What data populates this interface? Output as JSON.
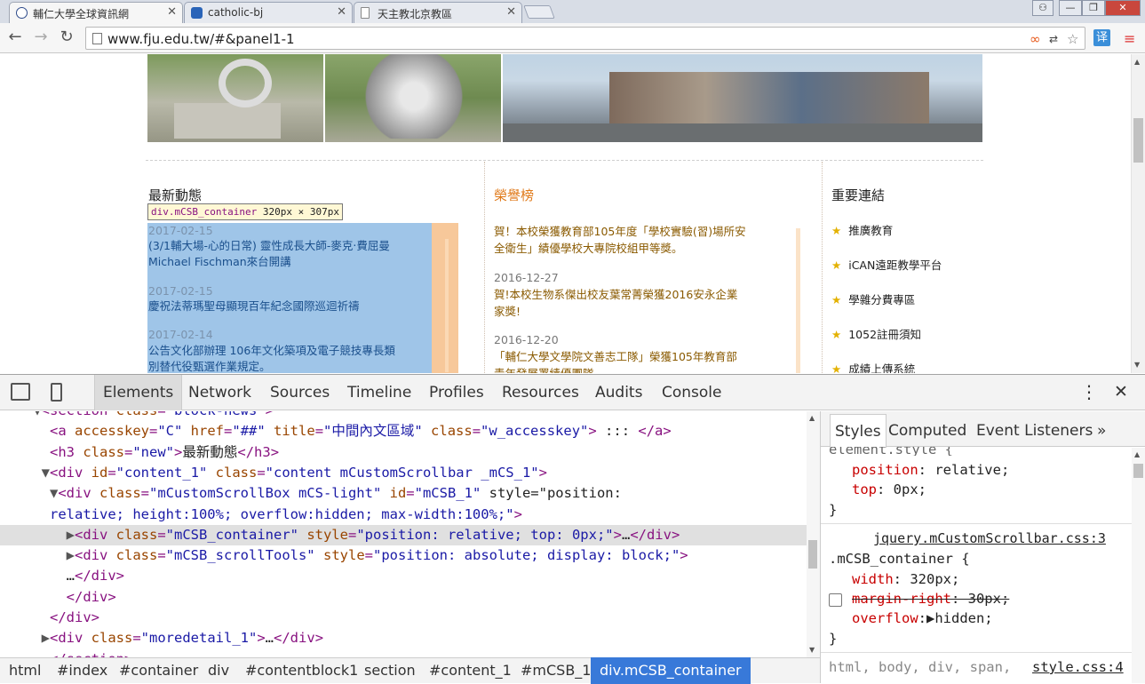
{
  "tabs": [
    {
      "title": "輔仁大學全球資訊網",
      "active": true
    },
    {
      "title": "catholic-bj",
      "active": false
    },
    {
      "title": "天主教北京教區",
      "active": false
    }
  ],
  "window": {
    "user_icon": "person-icon",
    "min": "—",
    "max": "❐",
    "close": "✕"
  },
  "url": "www.fju.edu.tw/#&panel1-1",
  "columns": {
    "news": "最新動態",
    "honor": "榮譽榜",
    "links": "重要連結"
  },
  "tooltip": {
    "selector": "div.mCSB_container",
    "size": "320px × 307px"
  },
  "news_items": [
    {
      "date": "2017-02-15",
      "lines": [
        "(3/1輔大場-心的日常) 靈性成長大師-麥克‧費屈曼",
        "Michael Fischman來台開講"
      ]
    },
    {
      "date": "2017-02-15",
      "lines": [
        "慶祝法蒂瑪聖母顯現百年紀念國際巡迴祈禱",
        "..."
      ]
    },
    {
      "date": "2017-02-14",
      "lines": [
        "公告文化部辦理 106年文化築項及電子競技專長類",
        "別替代役甄選作業規定。"
      ]
    }
  ],
  "honor_items": [
    {
      "date": "",
      "lines": [
        "賀！本校榮獲教育部105年度「學校實驗(習)場所安",
        "全衛生」績優學校大專院校組甲等獎。"
      ]
    },
    {
      "date": "2016-12-27",
      "lines": [
        "賀!本校生物系傑出校友葉常菁榮獲2016安永企業",
        "家獎!"
      ]
    },
    {
      "date": "2016-12-20",
      "lines": [
        "「輔仁大學文學院文善志工隊」榮獲105年教育部",
        "青年發展署績優團隊"
      ]
    }
  ],
  "links": [
    "推廣教育",
    "iCAN遠距教學平台",
    "學雜分費專區",
    "1052註冊須知",
    "成績上傳系統"
  ],
  "devtools": {
    "tabs": [
      "Elements",
      "Network",
      "Sources",
      "Timeline",
      "Profiles",
      "Resources",
      "Audits",
      "Console"
    ],
    "menu": "⋮",
    "close": "✕"
  },
  "dom": [
    {
      "pre": "    ▼",
      "html": "<section class=\"block-news\">"
    },
    {
      "pre": "      ",
      "html": "<a accesskey=\"C\" href=\"##\" title=\"中間內文區域\" class=\"w_accesskey\"> ::: </a>"
    },
    {
      "pre": "      ",
      "html": "<h3 class=\"new\">最新動態</h3>"
    },
    {
      "pre": "     ▼",
      "html": "<div id=\"content_1\" class=\"content mCustomScrollbar _mCS_1\">"
    },
    {
      "pre": "      ▼",
      "html": "<div class=\"mCustomScrollBox mCS-light\" id=\"mCSB_1\" style=\"position:"
    },
    {
      "pre": "      ",
      "html": "relative; height:100%; overflow:hidden; max-width:100%;\">"
    },
    {
      "pre": "        ▶",
      "html": "<div class=\"mCSB_container\" style=\"position: relative; top: 0px;\">…</div>"
    },
    {
      "pre": "        ▶",
      "html": "<div class=\"mCSB_scrollTools\" style=\"position: absolute; display: block;\">"
    },
    {
      "pre": "        ",
      "html": "…</div>"
    },
    {
      "pre": "        ",
      "html": "</div>"
    },
    {
      "pre": "      ",
      "html": "</div>"
    },
    {
      "pre": "     ▶",
      "html": "<div class=\"moredetail_1\">…</div>"
    },
    {
      "pre": "      ",
      "html": "</section>"
    }
  ],
  "breadcrumbs": [
    "html",
    "#index",
    "#container",
    "div",
    "#contentblock1",
    "section",
    "#content_1",
    "#mCSB_1",
    "div.mCSB_container"
  ],
  "styles_tabs": [
    "Styles",
    "Computed",
    "Event Listeners",
    "»"
  ],
  "styles": {
    "element_style": "element.style {",
    "l1p": "position",
    "l1v": ": relative;",
    "l2p": "top",
    "l2v": ": 0px;",
    "close": "}",
    "source": "jquery.mCustomScrollbar.css:3",
    "rule": ".mCSB_container {",
    "w_p": "width",
    "w_v": ": 320px;",
    "mr_p": "margin-right",
    "mr_v": ": 30px;",
    "of_p": "overflow",
    "of_v": ":▶hidden;",
    "close2": "}",
    "last_sel": "html, body, div, span,",
    "last_src": "style.css:4"
  }
}
